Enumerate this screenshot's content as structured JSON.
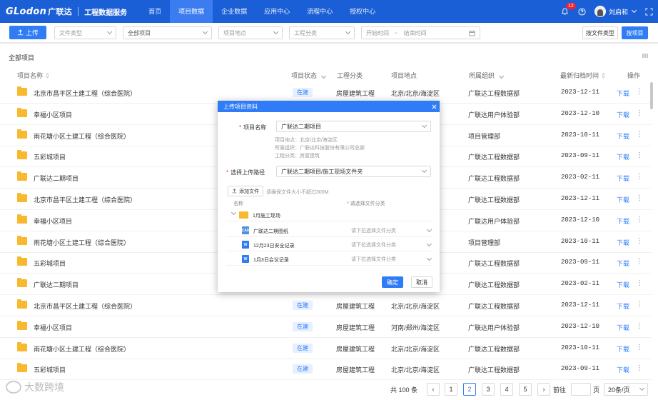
{
  "header": {
    "logo": "GLodon",
    "logo_cn": "广联达",
    "system_name": "工程数据服务",
    "nav": [
      "首页",
      "项目数据",
      "企业数据",
      "应用中心",
      "流程中心",
      "授权中心"
    ],
    "active_nav": 1,
    "notification_count": "12",
    "user_name": "刘启和"
  },
  "toolbar": {
    "upload_label": "上传",
    "file_type_placeholder": "文件类型",
    "project_select": "全部项目",
    "location_placeholder": "项目地点",
    "category_placeholder": "工程分类",
    "start_placeholder": "开始时间",
    "range_sep": "~",
    "end_placeholder": "结束时间",
    "by_type_label": "按文件类型",
    "by_project_label": "按项目"
  },
  "section_title": "全部项目",
  "table": {
    "columns": [
      "项目名称",
      "项目状态",
      "工程分类",
      "项目地点",
      "所属组织",
      "最新归档时间",
      "操作"
    ],
    "download_label": "下载",
    "rows": [
      {
        "name": "北京市昌平区土建工程（综合医院）",
        "status": "在建",
        "category": "房屋建筑工程",
        "location": "北京/北京/海淀区",
        "org": "广联达工程数据部",
        "date": "2023-12-11"
      },
      {
        "name": "幸福小区项目",
        "status": "",
        "category": "",
        "location": "",
        "org": "广联达用户体验部",
        "date": "2023-12-10"
      },
      {
        "name": "雨花塘小区土建工程（综合医院）",
        "status": "",
        "category": "",
        "location": "",
        "org": "项目管理部",
        "date": "2023-10-11"
      },
      {
        "name": "五彩城项目",
        "status": "",
        "category": "",
        "location": "",
        "org": "广联达工程数据部",
        "date": "2023-09-11"
      },
      {
        "name": "广联达二期项目",
        "status": "",
        "category": "",
        "location": "",
        "org": "广联达工程数据部",
        "date": "2023-02-11"
      },
      {
        "name": "北京市昌平区土建工程（综合医院）",
        "status": "",
        "category": "",
        "location": "",
        "org": "广联达工程数据部",
        "date": "2023-12-11"
      },
      {
        "name": "幸福小区项目",
        "status": "",
        "category": "",
        "location": "",
        "org": "广联达用户体验部",
        "date": "2023-12-10"
      },
      {
        "name": "雨花塘小区土建工程（综合医院）",
        "status": "",
        "category": "",
        "location": "",
        "org": "项目管理部",
        "date": "2023-10-11"
      },
      {
        "name": "五彩城项目",
        "status": "",
        "category": "",
        "location": "",
        "org": "广联达工程数据部",
        "date": "2023-09-11"
      },
      {
        "name": "广联达二期项目",
        "status": "",
        "category": "",
        "location": "",
        "org": "广联达工程数据部",
        "date": "2023-02-11"
      },
      {
        "name": "北京市昌平区土建工程（综合医院）",
        "status": "在建",
        "category": "房屋建筑工程",
        "location": "北京/北京/海淀区",
        "org": "广联达工程数据部",
        "date": "2023-12-11"
      },
      {
        "name": "幸福小区项目",
        "status": "在建",
        "category": "房屋建筑工程",
        "location": "河南/郑州/海淀区",
        "org": "广联达用户体验部",
        "date": "2023-12-10"
      },
      {
        "name": "雨花塘小区土建工程（综合医院）",
        "status": "在建",
        "category": "房屋建筑工程",
        "location": "北京/北京/海淀区",
        "org": "广联达工程数据部",
        "date": "2023-10-11"
      },
      {
        "name": "五彩城项目",
        "status": "在建",
        "category": "房屋建筑工程",
        "location": "北京/北京/海淀区",
        "org": "广联达工程数据部",
        "date": "2023-09-11"
      }
    ]
  },
  "pagination": {
    "total": "共 100 条",
    "pages": [
      "1",
      "2",
      "3",
      "4",
      "5"
    ],
    "active_page": "2",
    "goto_label": "前往",
    "page_unit": "页",
    "page_size": "20条/页"
  },
  "watermark": "大数跨境",
  "modal": {
    "title": "上传项目资料",
    "project_label": "项目名称",
    "project_value": "广联达二期项目",
    "info": [
      "项目地点：北京/北京/海淀区",
      "所属组织：广联达科技股份有限公司总部",
      "工程分类：房屋建筑"
    ],
    "path_label": "选择上传路径",
    "path_value": "广联达二期项目/施工现场文件夹",
    "add_file_label": "添加文件",
    "hint": "请确保文件大小不超过300M",
    "col_name": "名称",
    "col_type": "* 请选择文件分类",
    "folder_name": "1月施工现场",
    "files": [
      {
        "icon": "CAD",
        "color": "#4a90e2",
        "name": "广联达二期图纸",
        "select": "请下拉选择文件分类"
      },
      {
        "icon": "W",
        "color": "#2f7cf6",
        "name": "12月23日安全记录",
        "select": "请下拉选择文件分类"
      },
      {
        "icon": "W",
        "color": "#2f7cf6",
        "name": "1月3日会议记录",
        "select": "请下拉选择文件分类"
      }
    ],
    "confirm_label": "确定",
    "cancel_label": "取消"
  }
}
